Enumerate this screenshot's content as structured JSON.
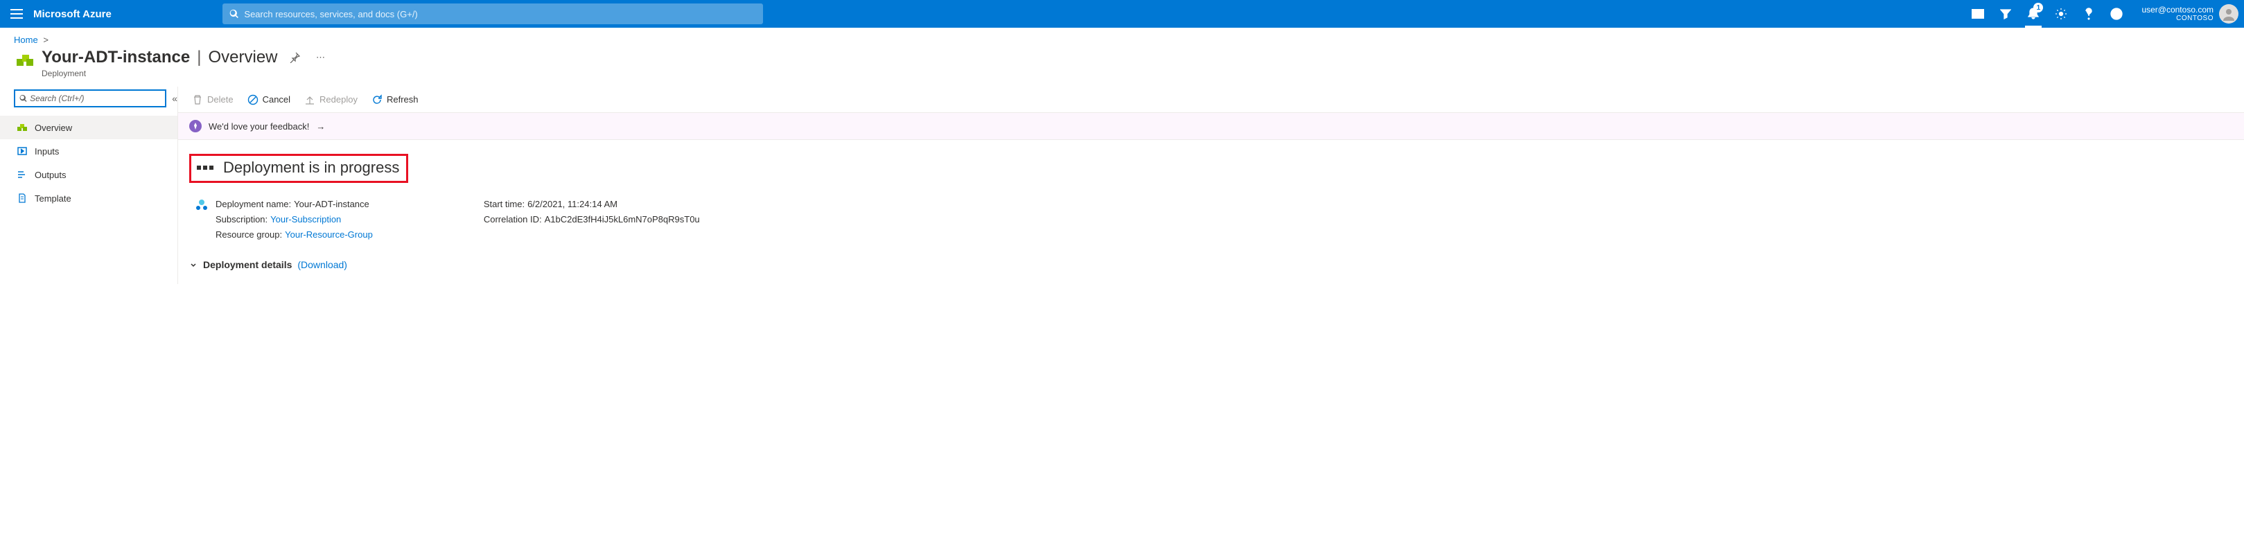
{
  "topbar": {
    "brand": "Microsoft Azure",
    "search_placeholder": "Search resources, services, and docs (G+/)",
    "notification_count": "1",
    "user_email": "user@contoso.com",
    "user_tenant": "CONTOSO"
  },
  "breadcrumb": {
    "home": "Home"
  },
  "header": {
    "resource_name": "Your-ADT-instance",
    "section": "Overview",
    "subtype": "Deployment"
  },
  "sidebar": {
    "search_placeholder": "Search (Ctrl+/)",
    "items": [
      {
        "label": "Overview"
      },
      {
        "label": "Inputs"
      },
      {
        "label": "Outputs"
      },
      {
        "label": "Template"
      }
    ]
  },
  "commands": {
    "delete": "Delete",
    "cancel": "Cancel",
    "redeploy": "Redeploy",
    "refresh": "Refresh"
  },
  "feedback": {
    "text": "We'd love your feedback!"
  },
  "status": {
    "headline": "Deployment is in progress"
  },
  "details": {
    "deployment_name_label": "Deployment name:",
    "deployment_name": "Your-ADT-instance",
    "subscription_label": "Subscription:",
    "subscription": "Your-Subscription",
    "resource_group_label": "Resource group:",
    "resource_group": "Your-Resource-Group",
    "start_time_label": "Start time:",
    "start_time": "6/2/2021, 11:24:14 AM",
    "correlation_label": "Correlation ID:",
    "correlation": "A1bC2dE3fH4iJ5kL6mN7oP8qR9sT0u"
  },
  "deployment_details": {
    "label": "Deployment details",
    "download": "(Download)"
  }
}
